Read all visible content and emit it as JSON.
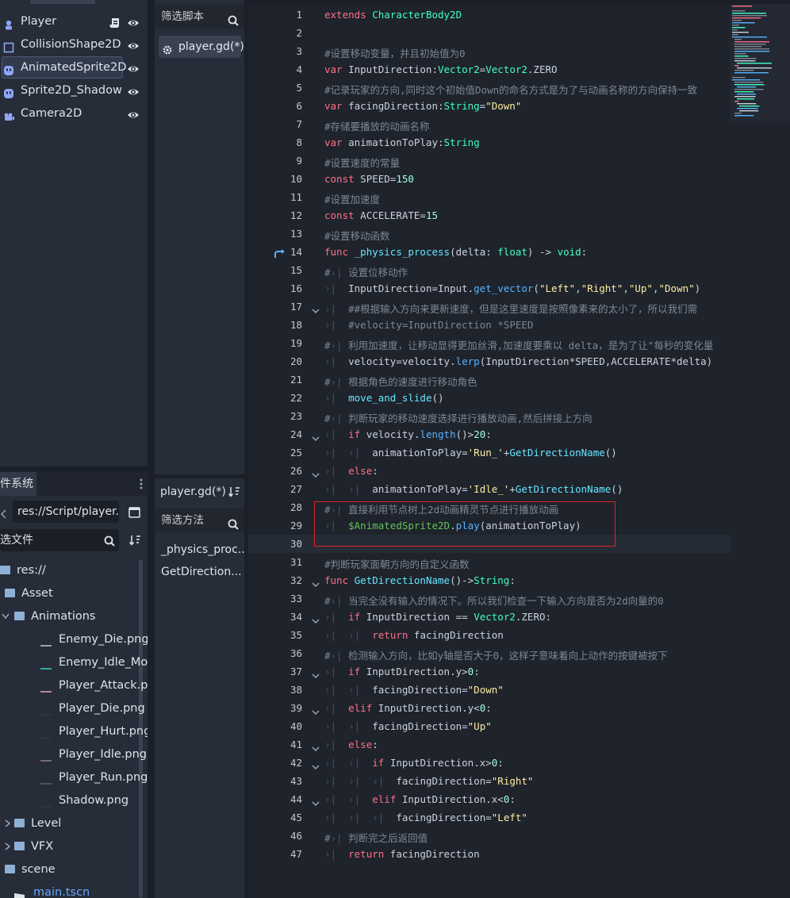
{
  "scene_tree": {
    "nodes": [
      {
        "label": "Player",
        "icon": "character-body-icon",
        "selected": false
      },
      {
        "label": "CollisionShape2D",
        "icon": "collision-shape-icon",
        "selected": false
      },
      {
        "label": "AnimatedSprite2D",
        "icon": "animated-sprite-icon",
        "selected": true
      },
      {
        "label": "Sprite2D_Shadow",
        "icon": "sprite-icon",
        "selected": false
      },
      {
        "label": "Camera2D",
        "icon": "camera-icon",
        "selected": false
      }
    ]
  },
  "filesystem": {
    "tab_label": "件系统",
    "path": "res://Script/player.",
    "filter_placeholder": "选文件",
    "items": [
      {
        "label": "res://",
        "type": "folder",
        "indent": 0
      },
      {
        "label": "Asset",
        "type": "folder",
        "indent": 1
      },
      {
        "label": "Animations",
        "type": "folder",
        "indent": 2
      },
      {
        "label": "Enemy_Die.png",
        "type": "file",
        "indent": 3
      },
      {
        "label": "Enemy_Idle_Mo...",
        "type": "file",
        "indent": 3
      },
      {
        "label": "Player_Attack.p...",
        "type": "file",
        "indent": 3
      },
      {
        "label": "Player_Die.png",
        "type": "file",
        "indent": 3
      },
      {
        "label": "Player_Hurt.png",
        "type": "file",
        "indent": 3
      },
      {
        "label": "Player_Idle.png",
        "type": "file",
        "indent": 3
      },
      {
        "label": "Player_Run.png",
        "type": "file",
        "indent": 3
      },
      {
        "label": "Shadow.png",
        "type": "file",
        "indent": 3
      },
      {
        "label": "Level",
        "type": "folder",
        "indent": 1
      },
      {
        "label": "VFX",
        "type": "folder",
        "indent": 1
      },
      {
        "label": "scene",
        "type": "folder",
        "indent": 0
      },
      {
        "label": "main.tscn",
        "type": "scene",
        "indent": 1
      }
    ]
  },
  "scripts_panel": {
    "filter_label": "筛选脚本",
    "script_item": "player.gd(*)",
    "current_script": "player.gd(*)",
    "methods_filter_label": "筛选方法",
    "methods": [
      "_physics_proc...",
      "GetDirection..."
    ]
  },
  "editor": {
    "current_line": 30,
    "lines": [
      "extends CharacterBody2D",
      "",
      "#设置移动变量，并且初始值为0",
      "var InputDirection:Vector2=Vector2.ZERO",
      "#记录玩家的方向,同时这个初始值Down的命名方式是为了与动画名称的方向保持一致",
      "var facingDirection:String=\"Down\"",
      "#存储要播放的动画名称",
      "var animationToPlay:String",
      "#设置速度的常量",
      "const SPEED=150",
      "#设置加速度",
      "const ACCELERATE=15",
      "#设置移动函数",
      "func _physics_process(delta: float) -> void:",
      "#\t设置位移动作",
      "InputDirection=Input.get_vector(\"Left\",\"Right\",\"Up\",\"Down\")",
      "##根据输入方向来更新速度，但是这里速度是按照像素来的太小了，所以我们需",
      "#velocity=InputDirection *SPEED",
      "利用加速度，让移动显得更加丝滑,加速度要乘以 delta，是为了让\"每秒的变化量",
      "velocity=velocity.lerp(InputDirection*SPEED,ACCELERATE*delta)",
      "根据角色的速度进行移动角色",
      "move_and_slide()",
      "判断玩家的移动速度选择进行播放动画,然后拼接上方向",
      "if velocity.length()>20:",
      "animationToPlay='Run_'+GetDirectionName()",
      "else:",
      "animationToPlay='Idle_'+GetDirectionName()",
      "直接利用节点树上2d动画精灵节点进行播放动画",
      "$AnimatedSprite2D.play(animationToPlay)",
      "",
      "#判断玩家面朝方向的自定义函数",
      "func GetDirectionName()->String:",
      "当完全没有输入的情况下。所以我们检查一下输入方向是否为2d向量的0",
      "if InputDirection == Vector2.ZERO:",
      "return facingDirection",
      "检测输入方向，比如y轴是否大于0，这样子意味着向上动作的按键被按下",
      "if InputDirection.y>0:",
      "facingDirection=\"Down\"",
      "elif InputDirection.y<0:",
      "facingDirection=\"Up\"",
      "else:",
      "if InputDirection.x>0:",
      "facingDirection=\"Right\"",
      "elif InputDirection.x<0:",
      "facingDirection=\"Left\"",
      "判断完之后返回值",
      "return facingDirection"
    ]
  },
  "colors": {
    "keyword": "#ff7085",
    "type": "#42ffc2",
    "string": "#ffeda1",
    "comment": "#7f8796",
    "function": "#57b3ff",
    "highlight_box": "#e0242c"
  }
}
